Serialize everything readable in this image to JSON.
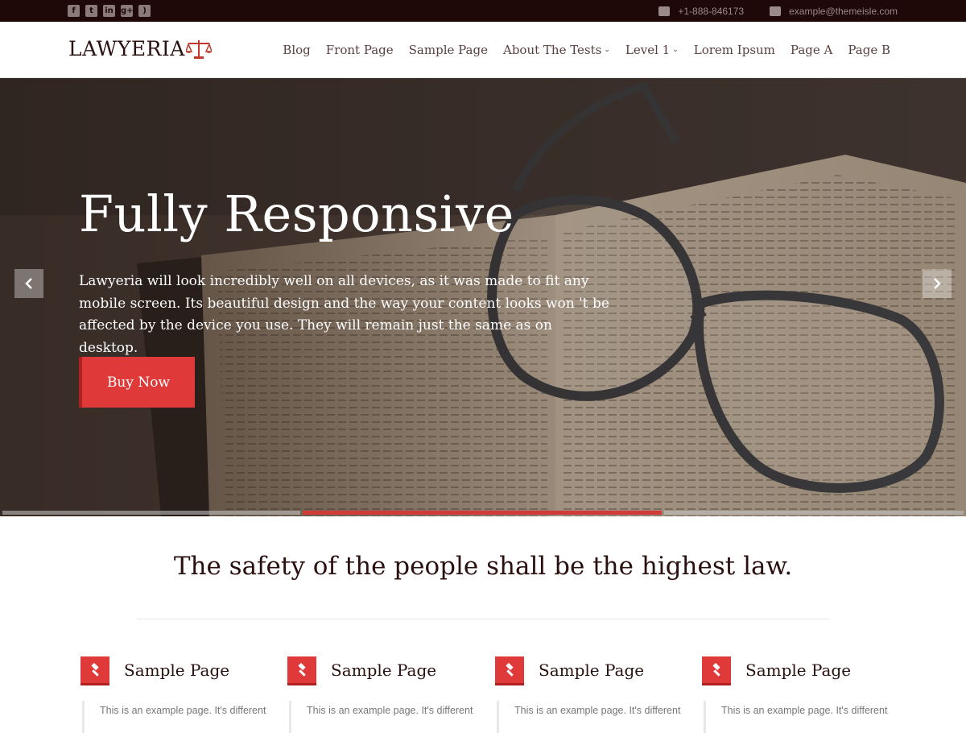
{
  "topbar": {
    "social_icons": [
      "facebook-icon",
      "twitter-icon",
      "linkedin-icon",
      "google-plus-icon",
      "rss-icon"
    ],
    "phone": "+1-888-846173",
    "email": "example@themeisle.com"
  },
  "header": {
    "logo": "LAWYERIA",
    "nav": [
      {
        "label": "Blog",
        "has_children": false
      },
      {
        "label": "Front Page",
        "has_children": false
      },
      {
        "label": "Sample Page",
        "has_children": false
      },
      {
        "label": "About The Tests",
        "has_children": true
      },
      {
        "label": "Level 1",
        "has_children": true
      },
      {
        "label": "Lorem Ipsum",
        "has_children": false
      },
      {
        "label": "Page A",
        "has_children": false
      },
      {
        "label": "Page B",
        "has_children": false
      }
    ]
  },
  "hero": {
    "title": "Fully Responsive",
    "text": "Lawyeria will look incredibly well on all devices, as it was made to fit any mobile screen. Its beautiful design and the way your content looks won 't be affected by the device you use. They will remain just the same as on desktop.",
    "button": "Buy Now",
    "slides_total": 3,
    "active_slide": 2
  },
  "tagline": "The safety of the people shall be the highest law.",
  "features": [
    {
      "title": "Sample Page",
      "body": "This is an example page. It's different",
      "icon": "gavel-icon"
    },
    {
      "title": "Sample Page",
      "body": "This is an example page. It's different",
      "icon": "gavel-icon"
    },
    {
      "title": "Sample Page",
      "body": "This is an example page. It's different",
      "icon": "gavel-icon"
    },
    {
      "title": "Sample Page",
      "body": "This is an example page. It's different",
      "icon": "gavel-icon"
    }
  ],
  "colors": {
    "accent": "#e0393a",
    "topbar": "#1f0808",
    "text_dark": "#2b1010"
  }
}
